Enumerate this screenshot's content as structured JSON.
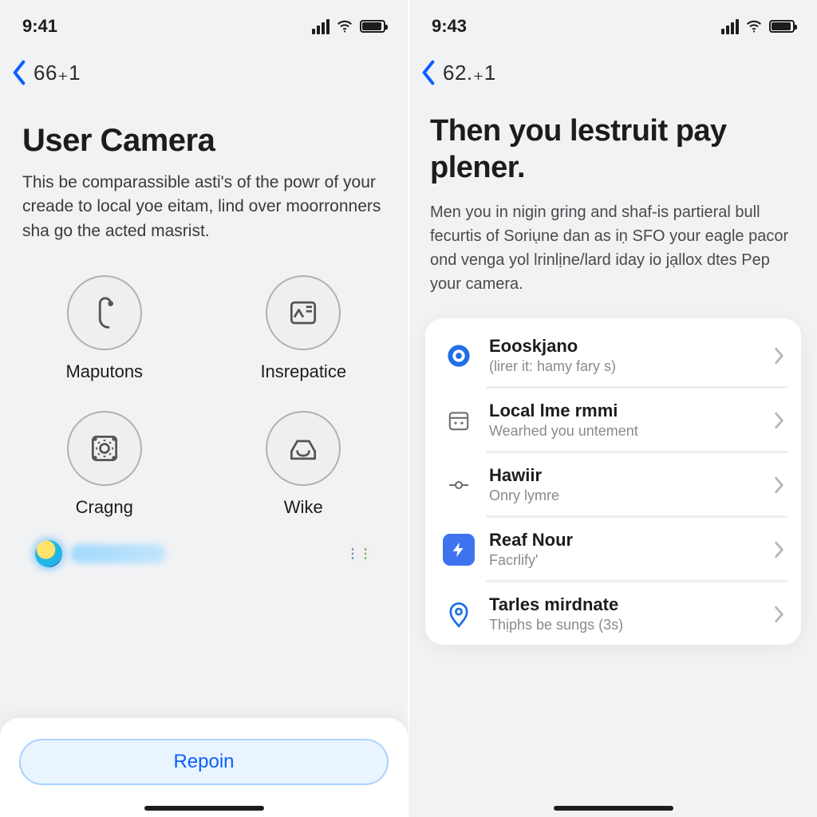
{
  "phoneA": {
    "status": {
      "time": "9:41"
    },
    "nav": {
      "back_label": "66₊1"
    },
    "heading": {
      "title": "User  Camera",
      "body": "This be comparassible asti's of the powr of your creade to local yoe eitam, lind over moorronners sha go the acted masrist."
    },
    "grid": [
      {
        "label": "Maputons",
        "icon": "hook"
      },
      {
        "label": "Insrepatice",
        "icon": "card"
      },
      {
        "label": "Cragng",
        "icon": "gear-frame"
      },
      {
        "label": "Wike",
        "icon": "inbox"
      }
    ],
    "button_label": "Repoin"
  },
  "phoneB": {
    "status": {
      "time": "9:43"
    },
    "nav": {
      "back_label": "62.₊1"
    },
    "heading": {
      "title": "Then you lestruit pay plener.",
      "body": "Men you in nigin gring and shaf-is partieral bull fecurtis of Soriụne dan as iṇ SFO your eagle pacor ond venga yol lrinlịne/lard iday io jạllox dtes Pep your camera."
    },
    "list": [
      {
        "title": "Eooskjano",
        "subtitle": "(lirer it: hamy fary s)",
        "icon": "target-blue"
      },
      {
        "title": "Local lme rmmi",
        "subtitle": "Wearhed you untement",
        "icon": "calendar-gray"
      },
      {
        "title": "Hawiir",
        "subtitle": "Onry lymre",
        "icon": "node-gray"
      },
      {
        "title": "Reaf Nour",
        "subtitle": "Facrlify'",
        "icon": "bolt-blue"
      },
      {
        "title": "Tarles mirdnate",
        "subtitle": "Thịphs be sungs (3s)",
        "icon": "pin-blue"
      }
    ]
  }
}
